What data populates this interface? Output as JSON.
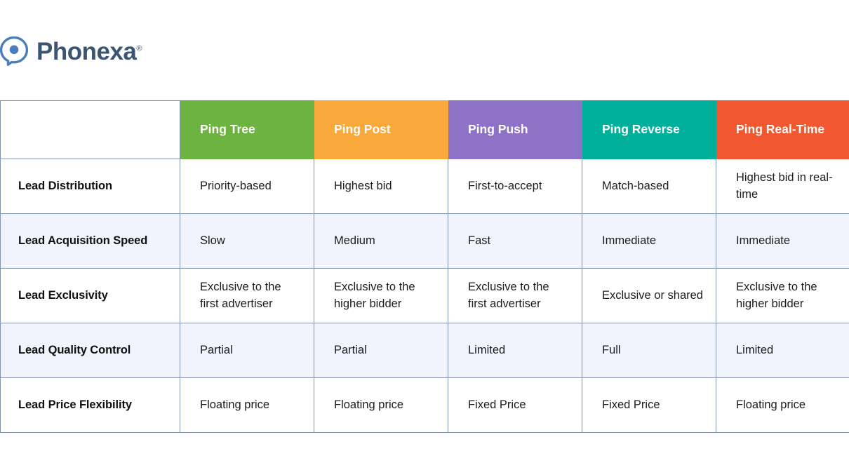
{
  "brand": {
    "logo_icon": "phonexa-pin-icon",
    "name": "Phonexa",
    "registered_mark": "®",
    "wordmark_color": "#3a5574",
    "mark_color": "#4a7ebb"
  },
  "table": {
    "corner_header": "",
    "headers": [
      {
        "label": "Ping Tree",
        "color": "#6cb33f"
      },
      {
        "label": "Ping Post",
        "color": "#f9a93a"
      },
      {
        "label": "Ping Push",
        "color": "#8e72c7"
      },
      {
        "label": "Ping Reverse",
        "color": "#00b09b"
      },
      {
        "label": "Ping Real-Time",
        "color": "#f2582f"
      }
    ],
    "row_alt_color": "#f1f4fc",
    "border_color": "#8193b2",
    "rows": [
      {
        "label": "Lead Distribution",
        "values": [
          "Priority-based",
          "Highest bid",
          "First-to-accept",
          "Match-based",
          "Highest bid in real-time"
        ]
      },
      {
        "label": "Lead Acquisition Speed",
        "values": [
          "Slow",
          "Medium",
          "Fast",
          "Immediate",
          "Immediate"
        ]
      },
      {
        "label": "Lead Exclusivity",
        "values": [
          "Exclusive to the first advertiser",
          "Exclusive to the higher bidder",
          "Exclusive to the first advertiser",
          "Exclusive or shared",
          "Exclusive to the higher bidder"
        ]
      },
      {
        "label": "Lead Quality Control",
        "values": [
          "Partial",
          "Partial",
          "Limited",
          "Full",
          "Limited"
        ]
      },
      {
        "label": "Lead Price Flexibility",
        "values": [
          "Floating price",
          "Floating price",
          "Fixed Price",
          "Fixed Price",
          "Floating price"
        ]
      }
    ]
  }
}
